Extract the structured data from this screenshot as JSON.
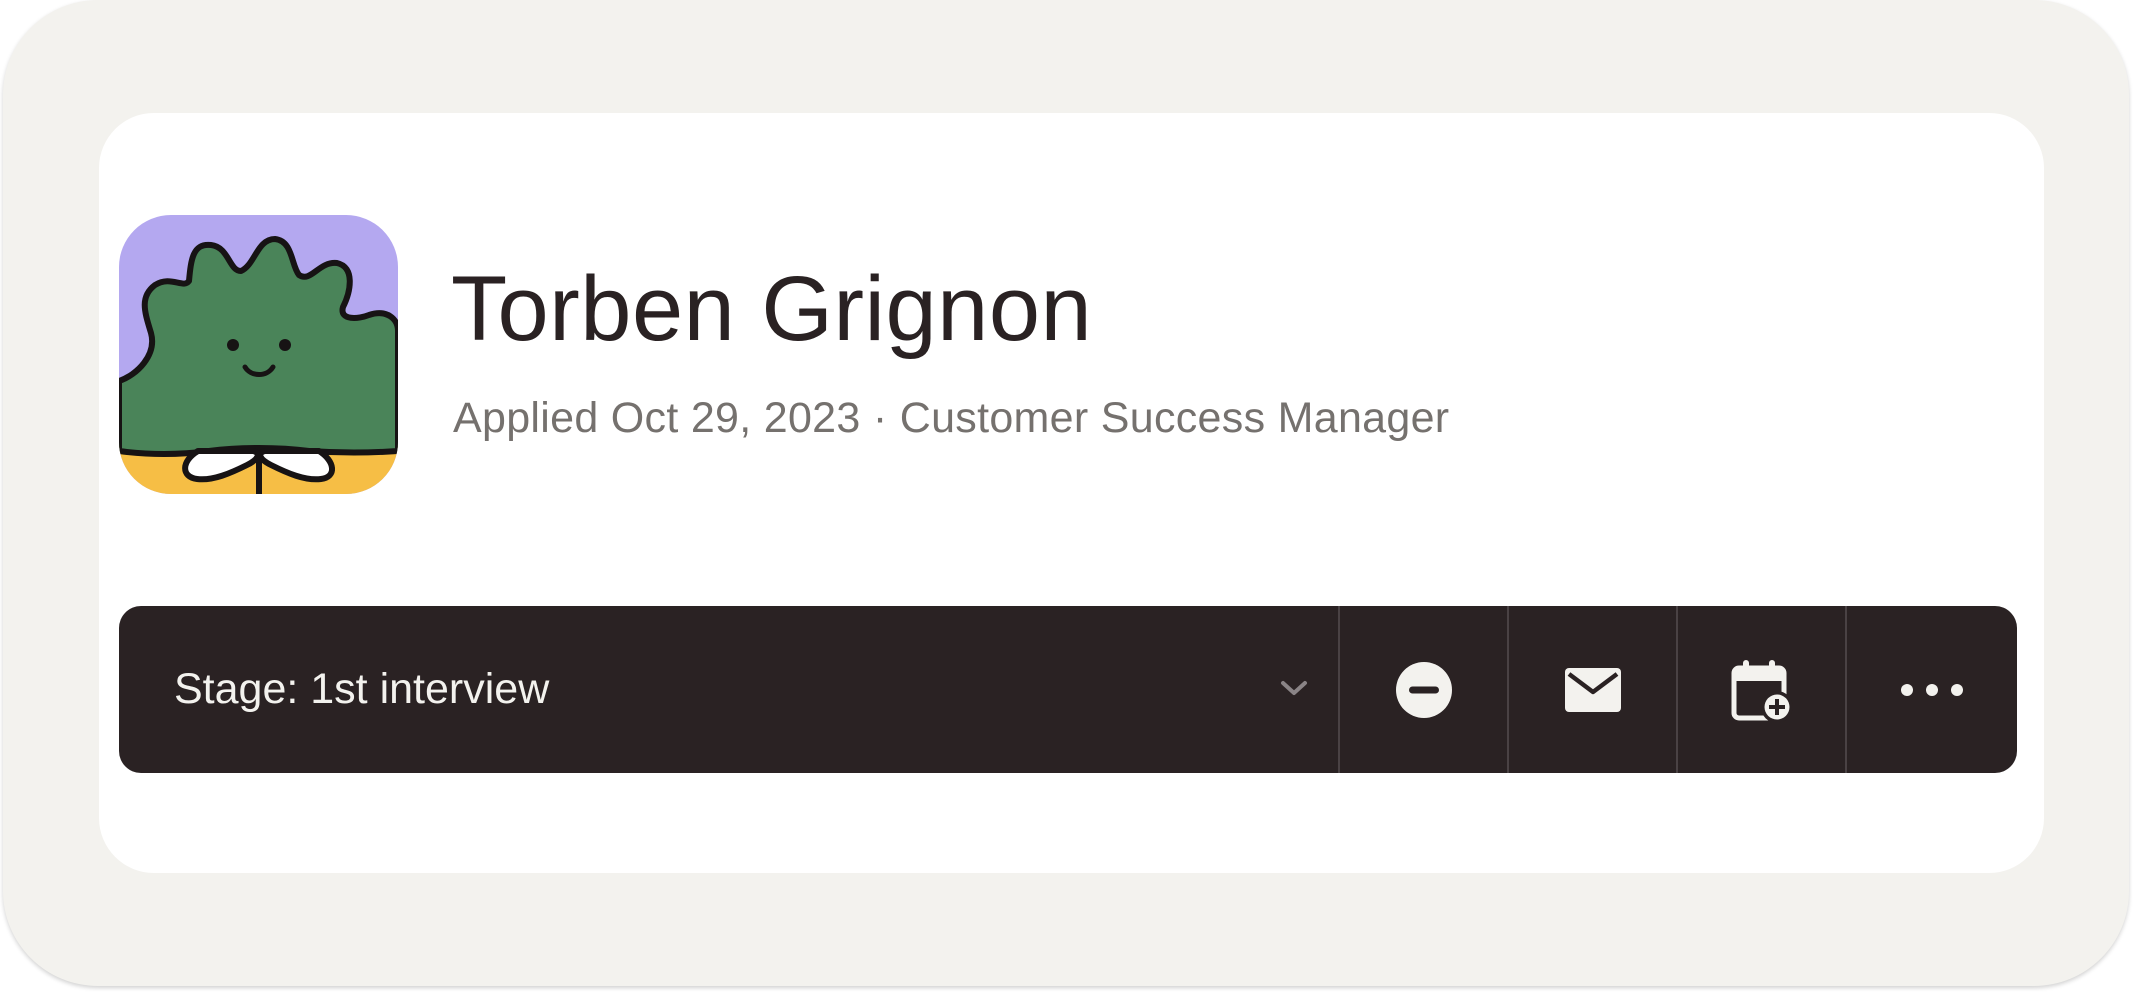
{
  "candidate": {
    "name": "Torben Grignon",
    "subtitle": "Applied Oct 29, 2023 · Customer Success Manager",
    "avatar_icon": "cartoon-plant-avatar"
  },
  "toolbar": {
    "stage_label": "Stage: 1st interview",
    "actions": [
      {
        "icon": "minus-circle-icon",
        "action": "reject"
      },
      {
        "icon": "mail-icon",
        "action": "email"
      },
      {
        "icon": "calendar-add-icon",
        "action": "schedule"
      },
      {
        "icon": "more-horizontal-icon",
        "action": "more"
      }
    ]
  },
  "colors": {
    "page_background": "#f3f2ee",
    "card_background": "#ffffff",
    "toolbar_background": "#2a2223",
    "toolbar_text": "#f3f2ee",
    "name_text": "#2a2223",
    "subtitle_text": "#75716e",
    "avatar_purple": "#b4a8f0",
    "avatar_green": "#4a8459",
    "avatar_yellow": "#f6be45"
  }
}
